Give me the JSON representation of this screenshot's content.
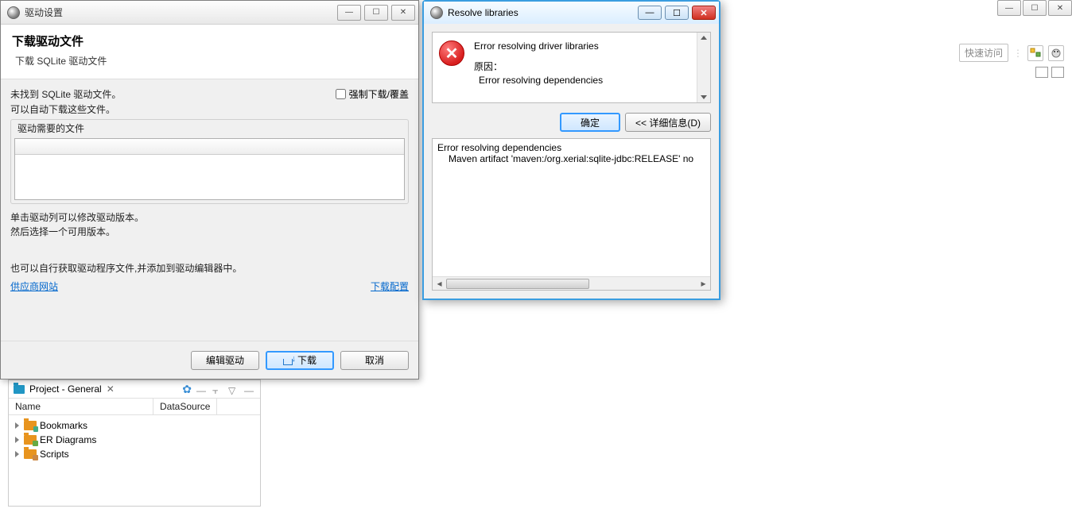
{
  "main_window": {
    "quick_access": "快速访问"
  },
  "dialog_driver": {
    "title": "驱动设置",
    "header_title": "下载驱动文件",
    "header_sub": "下载 SQLite 驱动文件",
    "not_found": "未找到 SQLite 驱动文件。",
    "force_label": "强制下载/覆盖",
    "can_auto": "可以自动下载这些文件。",
    "group_title": "驱动需要的文件",
    "hint1": "单击驱动列可以修改驱动版本。",
    "hint2": "然后选择一个可用版本。",
    "hint3": "也可以自行获取驱动程序文件,并添加到驱动编辑器中。",
    "link_vendor": "供应商网站",
    "link_config": "下载配置",
    "btn_edit": "编辑驱动",
    "btn_download": "下载",
    "btn_cancel": "取消"
  },
  "dialog_resolve": {
    "title": "Resolve libraries",
    "error_title": "Error resolving driver libraries",
    "reason_label": "原因：",
    "reason_text": "Error resolving dependencies",
    "btn_ok": "确定",
    "btn_details": "<< 详细信息(D)",
    "details_line1": "Error resolving dependencies",
    "details_line2": "Maven artifact 'maven:/org.xerial:sqlite-jdbc:RELEASE' no"
  },
  "project_panel": {
    "tab_label": "Project - General",
    "col_name": "Name",
    "col_datasource": "DataSource",
    "items": [
      {
        "label": "Bookmarks"
      },
      {
        "label": "ER Diagrams"
      },
      {
        "label": "Scripts"
      }
    ]
  }
}
